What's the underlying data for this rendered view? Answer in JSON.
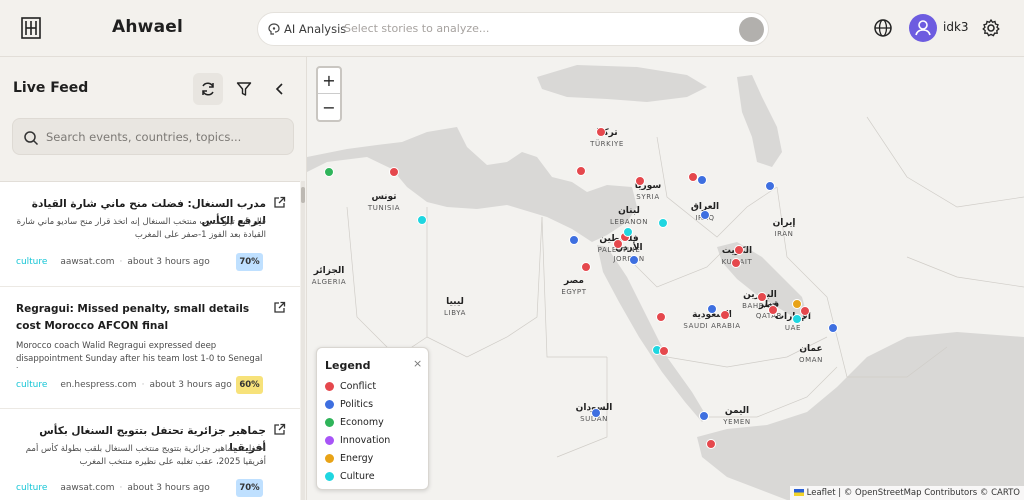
{
  "header": {
    "title": "Ahwael",
    "ai_label": "AI Analysis",
    "ai_placeholder": "Select stories to analyze...",
    "username": "idk3"
  },
  "sidebar": {
    "title": "Live Feed",
    "search_placeholder": "Search events, countries, topics..."
  },
  "feed": [
    {
      "title": "مدرب السنغال: فضلت منح ماني شارة القيادة ليرفع الكأس",
      "body": "قال باب تياو مدرب منتخب السنغال إنه اتخذ قرار منح ساديو ماني شارة القيادة بعد الفوز 1-صفر على المغرب",
      "category": "culture",
      "source": "aawsat.com",
      "time": "about 3 hours ago",
      "score": "70%",
      "rtl": true
    },
    {
      "title": "Regragui: Missed penalty, small details cost Morocco AFCON final",
      "body": "Morocco coach Walid Regragui expressed deep disappointment Sunday after his team lost 1-0 to Senegal i...",
      "category": "culture",
      "source": "en.hespress.com",
      "time": "about 3 hours ago",
      "score": "60%",
      "rtl": false
    },
    {
      "title": "جماهير جزائرية تحتفل بتتويج السنغال بكأس أفريقيا",
      "body": "احتفلت جماهير جزائرية بتتويج منتخب السنغال بلقب بطولة كأس أمم أفريقيا 2025، عقب تغلبه على نظيره منتخب المغرب",
      "category": "culture",
      "source": "aawsat.com",
      "time": "about 3 hours ago",
      "score": "70%",
      "rtl": true
    }
  ],
  "map": {
    "zoom_in": "+",
    "zoom_out": "−",
    "legend_title": "Legend",
    "legend_close": "×",
    "legend": [
      {
        "label": "Conflict",
        "color": "#e5484d"
      },
      {
        "label": "Politics",
        "color": "#3e6fe0"
      },
      {
        "label": "Economy",
        "color": "#2fb45a"
      },
      {
        "label": "Innovation",
        "color": "#a855f7"
      },
      {
        "label": "Energy",
        "color": "#e8a317"
      },
      {
        "label": "Culture",
        "color": "#1fd6e0"
      }
    ],
    "attribution_leaflet": "Leaflet",
    "attribution_rest": " | © OpenStreetMap Contributors © CARTO",
    "countries": [
      {
        "ar": "تركيا",
        "en": "TÜRKIYE"
      },
      {
        "ar": "تونس",
        "en": "TUNISIA"
      },
      {
        "ar": "سوريا",
        "en": "SYRIA"
      },
      {
        "ar": "لبنان",
        "en": "LEBANON"
      },
      {
        "ar": "العراق",
        "en": "IRAQ"
      },
      {
        "ar": "إيران",
        "en": "IRAN"
      },
      {
        "ar": "فلسطين",
        "en": "PALESTINE"
      },
      {
        "ar": "الأردن",
        "en": "JORDAN"
      },
      {
        "ar": "الكويت",
        "en": "KUWAIT"
      },
      {
        "ar": "الجزائر",
        "en": "ALGERIA"
      },
      {
        "ar": "مصر",
        "en": "EGYPT"
      },
      {
        "ar": "البحرين",
        "en": "BAHRAIN"
      },
      {
        "ar": "قطر",
        "en": "QATAR"
      },
      {
        "ar": "ليبيا",
        "en": "LIBYA"
      },
      {
        "ar": "السعودية",
        "en": "SAUDI ARABIA"
      },
      {
        "ar": "الإمارات",
        "en": "UAE"
      },
      {
        "ar": "عمان",
        "en": "OMAN"
      },
      {
        "ar": "السودان",
        "en": "SUDAN"
      },
      {
        "ar": "اليمن",
        "en": "YEMEN"
      }
    ],
    "markers": [
      {
        "category": "Conflict"
      },
      {
        "category": "Conflict"
      },
      {
        "category": "Economy"
      },
      {
        "category": "Conflict"
      },
      {
        "category": "Culture"
      },
      {
        "category": "Conflict"
      },
      {
        "category": "Conflict"
      },
      {
        "category": "Politics"
      },
      {
        "category": "Politics"
      },
      {
        "category": "Politics"
      },
      {
        "category": "Politics"
      },
      {
        "category": "Conflict"
      },
      {
        "category": "Culture"
      },
      {
        "category": "Conflict"
      },
      {
        "category": "Politics"
      },
      {
        "category": "Conflict"
      },
      {
        "category": "Conflict"
      },
      {
        "category": "Culture"
      },
      {
        "category": "Conflict"
      },
      {
        "category": "Conflict"
      },
      {
        "category": "Conflict"
      },
      {
        "category": "Conflict"
      },
      {
        "category": "Culture"
      },
      {
        "category": "Politics"
      },
      {
        "category": "Conflict"
      },
      {
        "category": "Culture"
      },
      {
        "category": "Conflict"
      },
      {
        "category": "Conflict"
      },
      {
        "category": "Politics"
      },
      {
        "category": "Politics"
      },
      {
        "category": "Conflict"
      },
      {
        "category": "Politics"
      },
      {
        "category": "Energy"
      }
    ]
  }
}
